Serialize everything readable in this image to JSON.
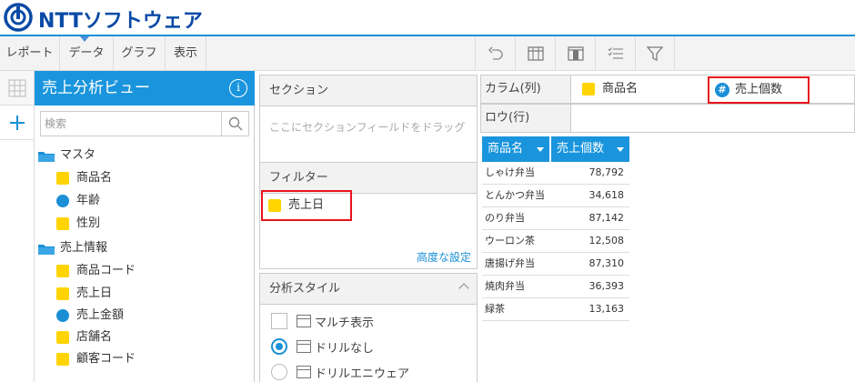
{
  "brand": {
    "logo_text": "NTTソフトウェア"
  },
  "menu": {
    "items": [
      "レポート",
      "データ",
      "グラフ",
      "表示"
    ]
  },
  "toolbar": {
    "icons": [
      "undo-icon",
      "table-icon",
      "column-icon",
      "list-icon",
      "filter-icon"
    ]
  },
  "data_panel": {
    "title": "売上分析ビュー",
    "search_placeholder": "検索",
    "folders": [
      {
        "label": "マスタ",
        "fields": [
          {
            "label": "商品名",
            "kind": "dimension"
          },
          {
            "label": "年齢",
            "kind": "measure"
          },
          {
            "label": "性別",
            "kind": "dimension"
          }
        ]
      },
      {
        "label": "売上情報",
        "fields": [
          {
            "label": "商品コード",
            "kind": "dimension"
          },
          {
            "label": "売上日",
            "kind": "dimension"
          },
          {
            "label": "売上金額",
            "kind": "measure"
          },
          {
            "label": "店舗名",
            "kind": "dimension"
          },
          {
            "label": "顧客コード",
            "kind": "dimension"
          }
        ]
      }
    ]
  },
  "section": {
    "title": "セクション",
    "hint": "ここにセクションフィールドをドラッグ"
  },
  "filter": {
    "title": "フィルター",
    "chip": "売上日",
    "advanced_link": "高度な設定"
  },
  "analysis_style": {
    "title": "分析スタイル",
    "multi_display": "マルチ表示",
    "drill_none": "ドリルなし",
    "drill_anywhere": "ドリルエニウェア"
  },
  "columns_shelf": {
    "label": "カラム(列)",
    "field1": "商品名",
    "field2": "売上個数"
  },
  "rows_shelf": {
    "label": "ロウ(行)"
  },
  "table": {
    "headers": [
      "商品名",
      "売上個数"
    ],
    "rows": [
      {
        "name": "しゃけ弁当",
        "value": "78,792"
      },
      {
        "name": "とんかつ弁当",
        "value": "34,618"
      },
      {
        "name": "のり弁当",
        "value": "87,142"
      },
      {
        "name": "ウーロン茶",
        "value": "12,508"
      },
      {
        "name": "唐揚げ弁当",
        "value": "87,310"
      },
      {
        "name": "焼肉弁当",
        "value": "36,393"
      },
      {
        "name": "緑茶",
        "value": "13,163"
      }
    ]
  },
  "colors": {
    "accent": "#1a95dd",
    "highlight": "#e8141b",
    "dimension": "#ffd400",
    "measure": "#1a8fd6"
  }
}
